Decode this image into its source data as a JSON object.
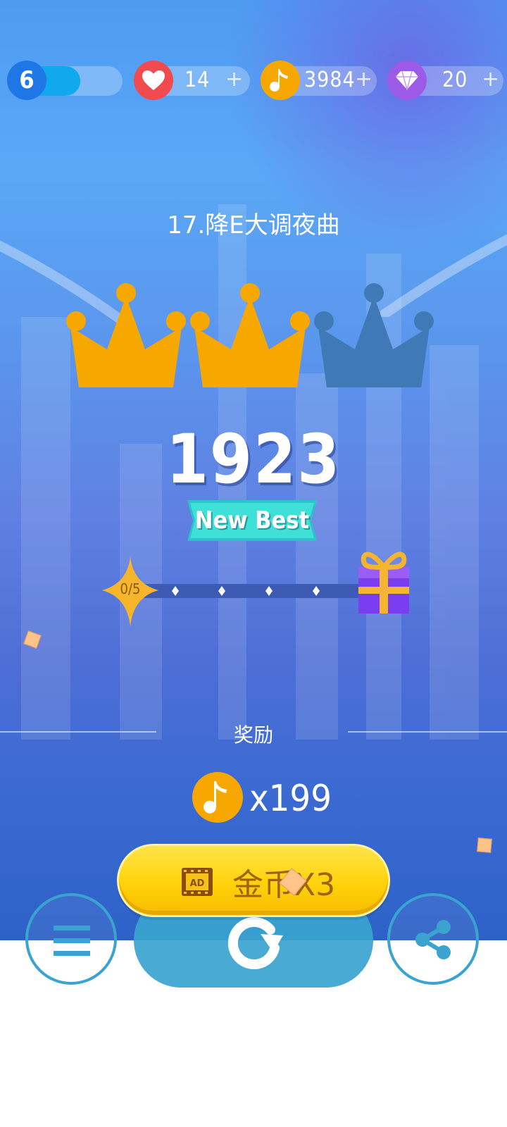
{
  "hud": {
    "level": "6",
    "level_progress": 0.6,
    "lives": "14",
    "lives_plus": "+",
    "coins": "3984",
    "coins_plus": "+",
    "gems": "20",
    "gems_plus": "+"
  },
  "song": {
    "title": "17.降E大调夜曲"
  },
  "result": {
    "crowns_earned": 2,
    "crowns_total": 3,
    "score": "1923",
    "badge": "New Best"
  },
  "progress": {
    "label": "0/5",
    "markers": 4
  },
  "reward": {
    "label": "奖励",
    "amount": "x199"
  },
  "buttons": {
    "coin_multiplier_label": "金币X3",
    "ad_icon_text": "AD"
  },
  "colors": {
    "crown_gold": "#f7a800",
    "crown_empty": "#3f79b6",
    "ribbon": "#3ed9d4",
    "coin_button": "#ffd20a",
    "round_button_ring": "#3aa3cf"
  },
  "icons": [
    "heart-icon",
    "music-note-icon",
    "diamond-icon",
    "crown-icon",
    "gift-icon",
    "star-icon",
    "ad-film-icon",
    "menu-icon",
    "replay-icon",
    "share-icon"
  ]
}
